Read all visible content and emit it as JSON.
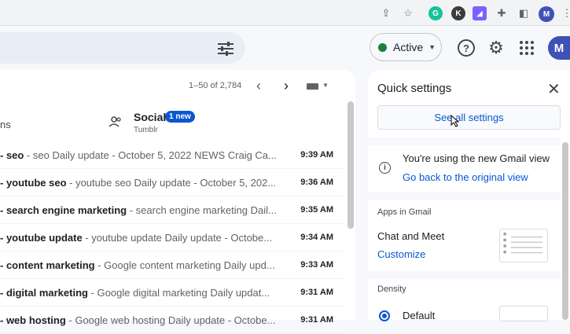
{
  "browser": {
    "extensions": [
      "share-icon",
      "star-icon",
      "grammarly-icon",
      "extension-k-icon",
      "extension-purple-icon",
      "puzzle-icon",
      "sidepanel-icon"
    ],
    "ext_k_label": "K",
    "profile_initial": "M"
  },
  "header": {
    "status_label": "Active",
    "avatar_initial": "M"
  },
  "mail": {
    "pager": "1–50 of 2,784",
    "tab_fragment": "ns",
    "social_tab": {
      "title": "Social",
      "badge": "1 new",
      "subtitle": "Tumblr"
    },
    "rows": [
      {
        "sender": "- seo",
        "snippet": " - seo Daily update - October 5, 2022 NEWS Craig Ca...",
        "time": "9:39 AM"
      },
      {
        "sender": "- youtube seo",
        "snippet": " - youtube seo Daily update - October 5, 202...",
        "time": "9:36 AM"
      },
      {
        "sender": "- search engine marketing",
        "snippet": " - search engine marketing Dail...",
        "time": "9:35 AM"
      },
      {
        "sender": "- youtube update",
        "snippet": " - youtube update Daily update - Octobe...",
        "time": "9:34 AM"
      },
      {
        "sender": "- content marketing",
        "snippet": " - Google content marketing Daily upd...",
        "time": "9:33 AM"
      },
      {
        "sender": "- digital marketing",
        "snippet": " - Google digital marketing Daily updat...",
        "time": "9:31 AM"
      },
      {
        "sender": "- web hosting",
        "snippet": " - Google web hosting Daily update - Octobe...",
        "time": "9:31 AM"
      }
    ]
  },
  "quick_settings": {
    "title": "Quick settings",
    "see_all": "See all settings",
    "view_notice": "You're using the new Gmail view",
    "go_back": "Go back to the original view",
    "apps_header": "Apps in Gmail",
    "chat_meet": "Chat and Meet",
    "customize": "Customize",
    "density_header": "Density",
    "density_default": "Default"
  },
  "colors": {
    "accent": "#0b57d0",
    "active_status": "#188038"
  }
}
